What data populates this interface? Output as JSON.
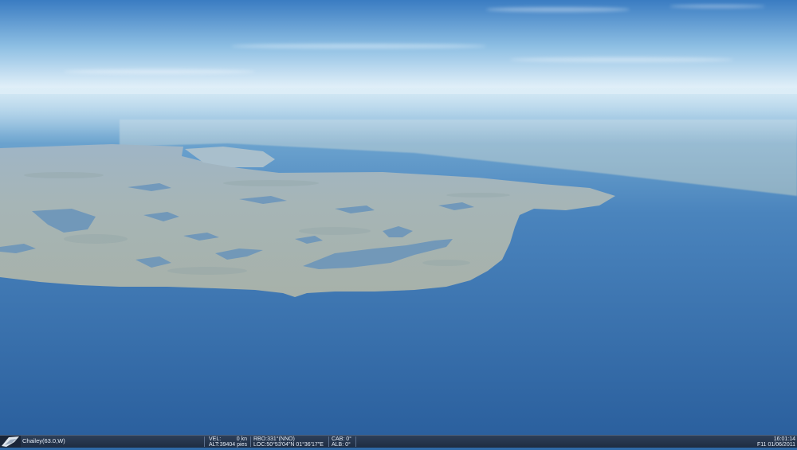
{
  "scene": {
    "sky_top": "#3d7fc4",
    "sky_horizon": "#e4f1fa",
    "sea_far": "#8fc0e0",
    "sea_near": "#2b63a0",
    "land_color": "#a4b3b0",
    "lake_color": "#5d8db8"
  },
  "statusbar": {
    "logo_icon": "wing-logo-icon",
    "location": "Chailey(63.0,W)",
    "vel_label": "VEL:",
    "vel_value": "0 kn",
    "alt_label": "ALT:",
    "alt_value": "39404 pies",
    "rbo": "RBO:331°(NNO)",
    "loc": "LOC:50°53'04\"N 01°36'17\"E",
    "cab": "CAB: 0°",
    "alb": "ALB: 0°",
    "time": "16:01:14",
    "date": "F11 01/06/2011"
  }
}
